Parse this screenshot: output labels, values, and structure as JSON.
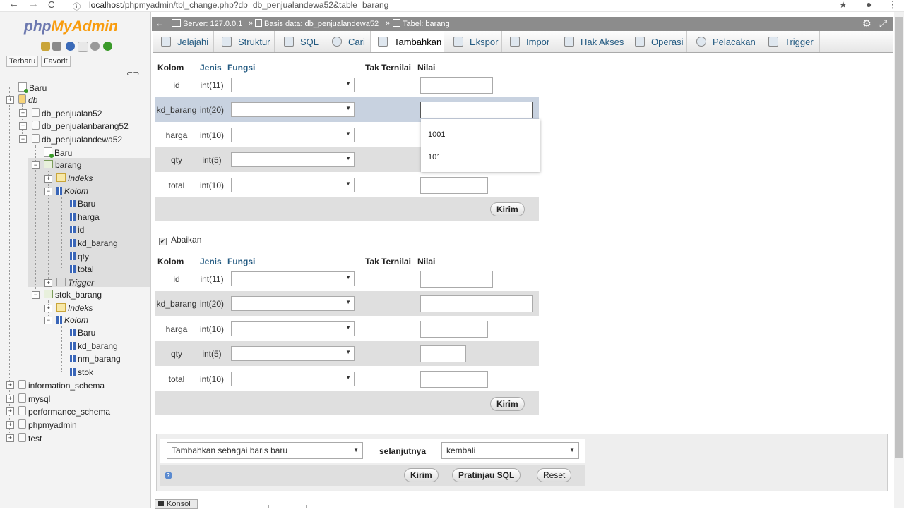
{
  "browser": {
    "url_host": "localhost",
    "url_path": "/phpmyadmin/tbl_change.php?db=db_penjualandewa52&table=barang",
    "back": "←",
    "forward": "→",
    "reload": "C",
    "star": "★",
    "account": "●",
    "menu": "⋮"
  },
  "logo": {
    "php": "php",
    "my": "MyAdmin"
  },
  "left_tabs": {
    "recent": "Terbaru",
    "favorite": "Favorit"
  },
  "tree": {
    "new": "Baru",
    "db": "db",
    "dbs": [
      "db_penjualan52",
      "db_penjualanbarang52",
      "db_penjualandewa52"
    ],
    "dewa_new": "Baru",
    "barang": "barang",
    "indeks": "Indeks",
    "kolom": "Kolom",
    "barang_cols": [
      "Baru",
      "harga",
      "id",
      "kd_barang",
      "qty",
      "total"
    ],
    "trigger": "Trigger",
    "stok_barang": "stok_barang",
    "stok_indeks": "Indeks",
    "stok_kolom": "Kolom",
    "stok_cols": [
      "Baru",
      "kd_barang",
      "nm_barang",
      "stok"
    ],
    "other_dbs": [
      "information_schema",
      "mysql",
      "performance_schema",
      "phpmyadmin",
      "test"
    ]
  },
  "serverbar": {
    "server": "Server: 127.0.0.1",
    "sep": "»",
    "database": "Basis data: db_penjualandewa52",
    "table": "Tabel: barang"
  },
  "tabs": [
    "Jelajahi",
    "Struktur",
    "SQL",
    "Cari",
    "Tambahkan",
    "Ekspor",
    "Impor",
    "Hak Akses",
    "Operasi",
    "Pelacakan",
    "Trigger"
  ],
  "form_headers": {
    "kolom": "Kolom",
    "jenis": "Jenis",
    "fungsi": "Fungsi",
    "tak_ternilai": "Tak Ternilai",
    "nilai": "Nilai"
  },
  "fields": [
    {
      "name": "id",
      "type": "int(11)"
    },
    {
      "name": "kd_barang",
      "type": "int(20)"
    },
    {
      "name": "harga",
      "type": "int(10)"
    },
    {
      "name": "qty",
      "type": "int(5)"
    },
    {
      "name": "total",
      "type": "int(10)"
    }
  ],
  "autocomplete": [
    "1001",
    "101"
  ],
  "submit_label": "Kirim",
  "ignore_label": "Abaikan",
  "ignore_check": "✔",
  "action": {
    "insert_mode": "Tambahkan sebagai baris baru",
    "next_label": "selanjutnya",
    "next_value": "kembali",
    "submit": "Kirim",
    "preview": "Pratinjau SQL",
    "reset": "Reset",
    "help_icon": "?"
  },
  "console": "Konsol",
  "colors": {
    "accent": "#235a81",
    "brand_php": "#6c78af",
    "brand_my": "#f89c0e"
  }
}
